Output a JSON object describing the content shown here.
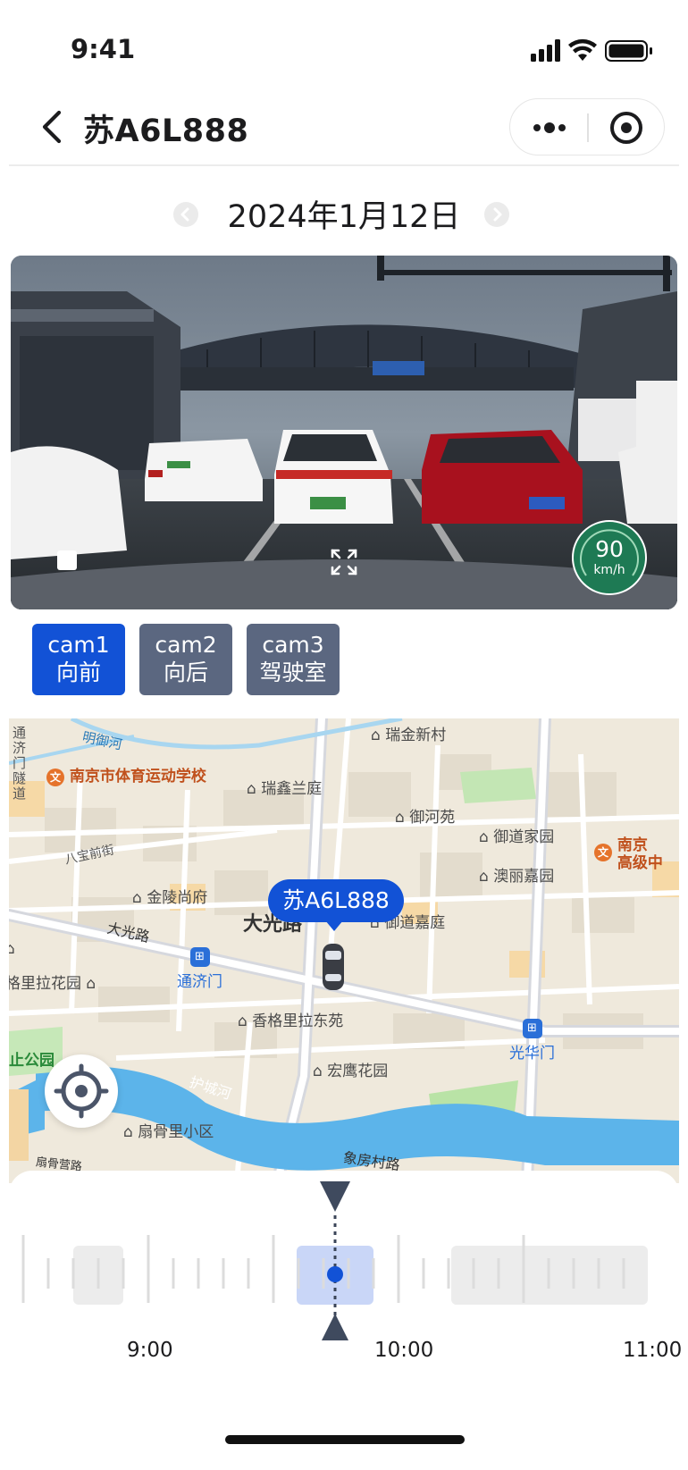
{
  "status_bar": {
    "time": "9:41"
  },
  "nav": {
    "title": "苏A6L888"
  },
  "date": {
    "label": "2024年1月12日"
  },
  "video": {
    "speed_value": "90",
    "speed_unit": "km/h"
  },
  "cams": [
    {
      "name": "cam1",
      "label": "向前",
      "active": true
    },
    {
      "name": "cam2",
      "label": "向后",
      "active": false
    },
    {
      "name": "cam3",
      "label": "驾驶室",
      "active": false
    }
  ],
  "map": {
    "vehicle_label": "苏A6L888",
    "places": {
      "p1": "瑞金新村",
      "p2": "南京市体育运动学校",
      "p3": "瑞鑫兰庭",
      "p4": "御河苑",
      "p5": "御道家园",
      "p6": "澳丽嘉园",
      "p7": "南京",
      "p8": "高级中",
      "p9": "金陵尚府",
      "p10": "御道嘉庭",
      "p11": "格里拉花园",
      "p12": "香格里拉东苑",
      "p13": "宏鹰花园",
      "p14": "扇骨里小区",
      "p15": "通济门",
      "p16": "光华门",
      "p17": "止公园"
    },
    "roads": {
      "r1": "明御河",
      "r2": "通济门隧道",
      "r3": "八宝前街",
      "r4": "大光路",
      "r5": "大光路",
      "r6": "护城河",
      "r7": "象房村路",
      "r8": "扇骨营路"
    }
  },
  "timeline": {
    "labels": [
      "9:00",
      "10:00",
      "11:00"
    ],
    "cursor_time_fraction": 0.5
  },
  "colors": {
    "accent": "#1252d6",
    "cam_inactive": "#5b6780",
    "speed_badge": "#1e7a54"
  }
}
